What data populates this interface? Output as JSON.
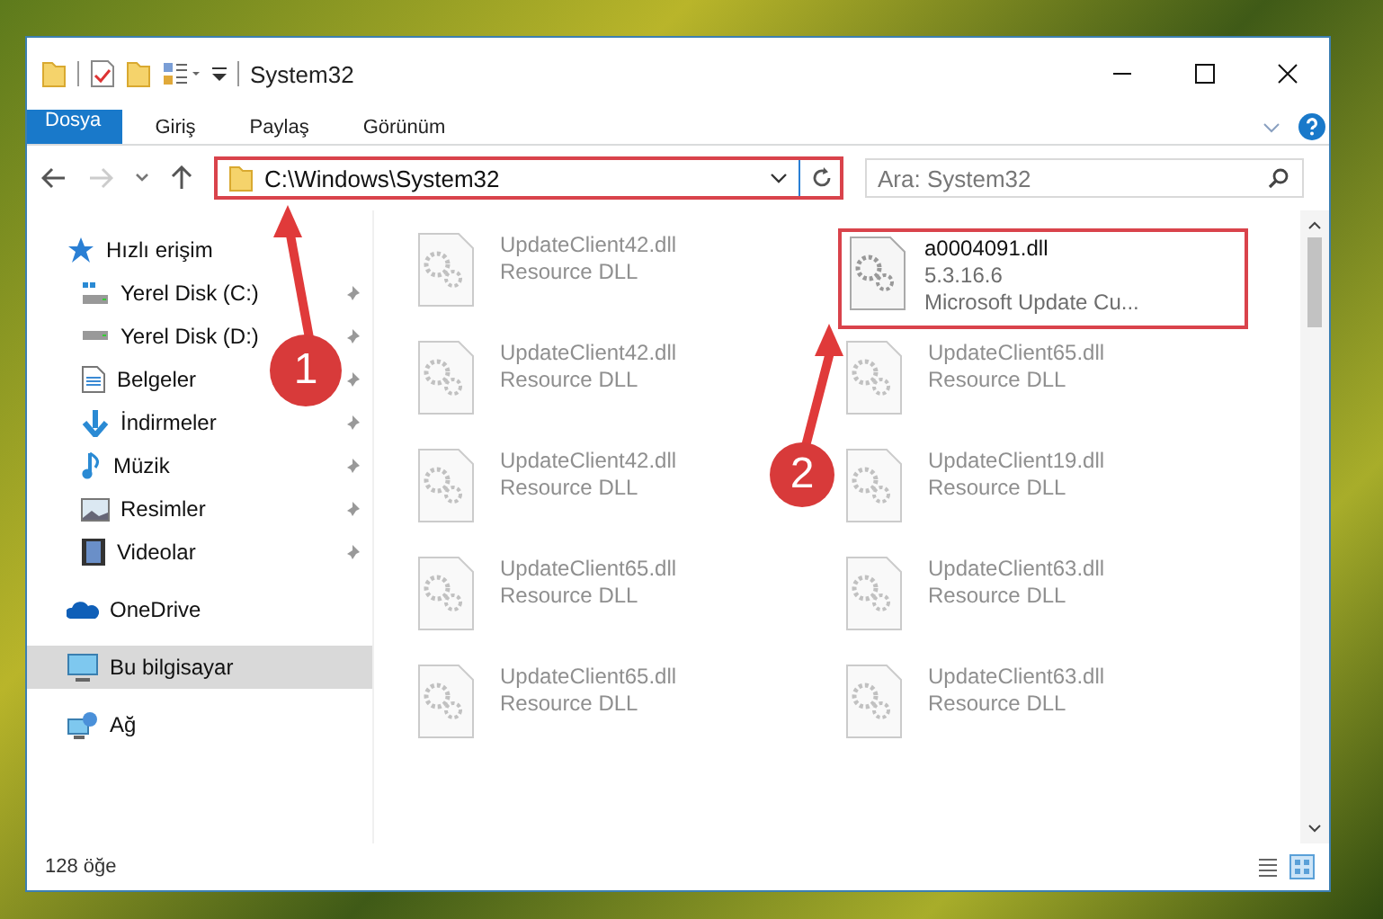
{
  "window": {
    "title": "System32"
  },
  "ribbon_tabs": [
    {
      "label": "Dosya",
      "kind": "file"
    },
    {
      "label": "Giriş",
      "kind": "tab"
    },
    {
      "label": "Paylaş",
      "kind": "tab"
    },
    {
      "label": "Görünüm",
      "kind": "tab"
    }
  ],
  "address": {
    "path": "C:\\Windows\\System32",
    "highlighted": true
  },
  "search": {
    "placeholder": "Ara: System32"
  },
  "nav": [
    {
      "label": "Hızlı erişim",
      "kind": "quick",
      "selected": false,
      "children": [
        {
          "label": "Yerel Disk (C:)",
          "kind": "disk-c",
          "pinned": true
        },
        {
          "label": "Yerel Disk (D:)",
          "kind": "disk",
          "pinned": true
        },
        {
          "label": "Belgeler",
          "kind": "docs",
          "pinned": true
        },
        {
          "label": "İndirmeler",
          "kind": "downloads",
          "pinned": true
        },
        {
          "label": "Müzik",
          "kind": "music",
          "pinned": true
        },
        {
          "label": "Resimler",
          "kind": "pictures",
          "pinned": true
        },
        {
          "label": "Videolar",
          "kind": "videos",
          "pinned": true
        }
      ]
    },
    {
      "label": "OneDrive",
      "kind": "cloud",
      "selected": false
    },
    {
      "label": "Bu bilgisayar",
      "kind": "pc",
      "selected": true
    },
    {
      "label": "Ağ",
      "kind": "network",
      "selected": false
    }
  ],
  "files": [
    {
      "name": "UpdateClient42.dll",
      "lines": [
        "Resource DLL"
      ],
      "blurred": true,
      "highlighted": false
    },
    {
      "name": "a0004091.dll",
      "lines": [
        "5.3.16.6",
        "Microsoft Update Cu..."
      ],
      "blurred": false,
      "highlighted": true
    },
    {
      "name": "UpdateClient42.dll",
      "lines": [
        "Resource DLL"
      ],
      "blurred": true,
      "highlighted": false
    },
    {
      "name": "UpdateClient65.dll",
      "lines": [
        "Resource DLL"
      ],
      "blurred": true,
      "highlighted": false
    },
    {
      "name": "UpdateClient42.dll",
      "lines": [
        "Resource DLL"
      ],
      "blurred": true,
      "highlighted": false
    },
    {
      "name": "UpdateClient19.dll",
      "lines": [
        "Resource DLL"
      ],
      "blurred": true,
      "highlighted": false
    },
    {
      "name": "UpdateClient65.dll",
      "lines": [
        "Resource DLL"
      ],
      "blurred": true,
      "highlighted": false
    },
    {
      "name": "UpdateClient63.dll",
      "lines": [
        "Resource DLL"
      ],
      "blurred": true,
      "highlighted": false
    },
    {
      "name": "UpdateClient65.dll",
      "lines": [
        "Resource DLL"
      ],
      "blurred": true,
      "highlighted": false
    },
    {
      "name": "UpdateClient63.dll",
      "lines": [
        "Resource DLL"
      ],
      "blurred": true,
      "highlighted": false
    }
  ],
  "status_bar": {
    "count": "128 öğe"
  },
  "annotations": [
    {
      "number": "1"
    },
    {
      "number": "2"
    }
  ]
}
